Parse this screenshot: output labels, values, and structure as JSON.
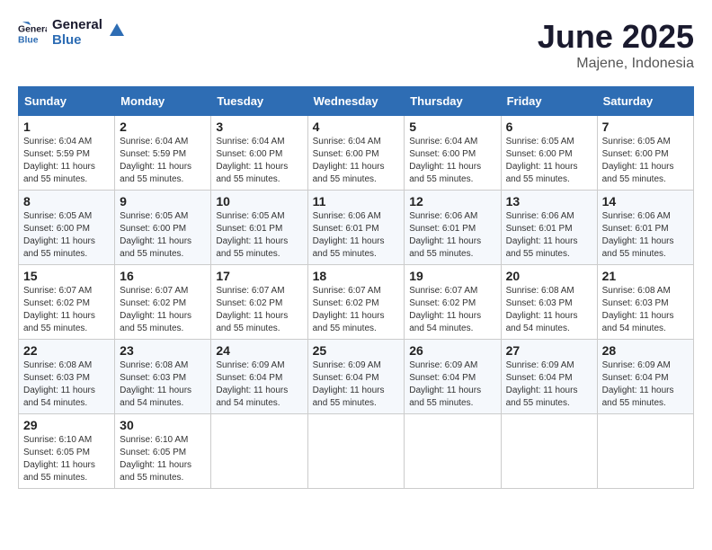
{
  "logo": {
    "line1": "General",
    "line2": "Blue"
  },
  "title": "June 2025",
  "location": "Majene, Indonesia",
  "days_header": [
    "Sunday",
    "Monday",
    "Tuesday",
    "Wednesday",
    "Thursday",
    "Friday",
    "Saturday"
  ],
  "weeks": [
    [
      {
        "day": "1",
        "sunrise": "6:04 AM",
        "sunset": "5:59 PM",
        "daylight": "11 hours and 55 minutes."
      },
      {
        "day": "2",
        "sunrise": "6:04 AM",
        "sunset": "5:59 PM",
        "daylight": "11 hours and 55 minutes."
      },
      {
        "day": "3",
        "sunrise": "6:04 AM",
        "sunset": "6:00 PM",
        "daylight": "11 hours and 55 minutes."
      },
      {
        "day": "4",
        "sunrise": "6:04 AM",
        "sunset": "6:00 PM",
        "daylight": "11 hours and 55 minutes."
      },
      {
        "day": "5",
        "sunrise": "6:04 AM",
        "sunset": "6:00 PM",
        "daylight": "11 hours and 55 minutes."
      },
      {
        "day": "6",
        "sunrise": "6:05 AM",
        "sunset": "6:00 PM",
        "daylight": "11 hours and 55 minutes."
      },
      {
        "day": "7",
        "sunrise": "6:05 AM",
        "sunset": "6:00 PM",
        "daylight": "11 hours and 55 minutes."
      }
    ],
    [
      {
        "day": "8",
        "sunrise": "6:05 AM",
        "sunset": "6:00 PM",
        "daylight": "11 hours and 55 minutes."
      },
      {
        "day": "9",
        "sunrise": "6:05 AM",
        "sunset": "6:00 PM",
        "daylight": "11 hours and 55 minutes."
      },
      {
        "day": "10",
        "sunrise": "6:05 AM",
        "sunset": "6:01 PM",
        "daylight": "11 hours and 55 minutes."
      },
      {
        "day": "11",
        "sunrise": "6:06 AM",
        "sunset": "6:01 PM",
        "daylight": "11 hours and 55 minutes."
      },
      {
        "day": "12",
        "sunrise": "6:06 AM",
        "sunset": "6:01 PM",
        "daylight": "11 hours and 55 minutes."
      },
      {
        "day": "13",
        "sunrise": "6:06 AM",
        "sunset": "6:01 PM",
        "daylight": "11 hours and 55 minutes."
      },
      {
        "day": "14",
        "sunrise": "6:06 AM",
        "sunset": "6:01 PM",
        "daylight": "11 hours and 55 minutes."
      }
    ],
    [
      {
        "day": "15",
        "sunrise": "6:07 AM",
        "sunset": "6:02 PM",
        "daylight": "11 hours and 55 minutes."
      },
      {
        "day": "16",
        "sunrise": "6:07 AM",
        "sunset": "6:02 PM",
        "daylight": "11 hours and 55 minutes."
      },
      {
        "day": "17",
        "sunrise": "6:07 AM",
        "sunset": "6:02 PM",
        "daylight": "11 hours and 55 minutes."
      },
      {
        "day": "18",
        "sunrise": "6:07 AM",
        "sunset": "6:02 PM",
        "daylight": "11 hours and 55 minutes."
      },
      {
        "day": "19",
        "sunrise": "6:07 AM",
        "sunset": "6:02 PM",
        "daylight": "11 hours and 54 minutes."
      },
      {
        "day": "20",
        "sunrise": "6:08 AM",
        "sunset": "6:03 PM",
        "daylight": "11 hours and 54 minutes."
      },
      {
        "day": "21",
        "sunrise": "6:08 AM",
        "sunset": "6:03 PM",
        "daylight": "11 hours and 54 minutes."
      }
    ],
    [
      {
        "day": "22",
        "sunrise": "6:08 AM",
        "sunset": "6:03 PM",
        "daylight": "11 hours and 54 minutes."
      },
      {
        "day": "23",
        "sunrise": "6:08 AM",
        "sunset": "6:03 PM",
        "daylight": "11 hours and 54 minutes."
      },
      {
        "day": "24",
        "sunrise": "6:09 AM",
        "sunset": "6:04 PM",
        "daylight": "11 hours and 54 minutes."
      },
      {
        "day": "25",
        "sunrise": "6:09 AM",
        "sunset": "6:04 PM",
        "daylight": "11 hours and 55 minutes."
      },
      {
        "day": "26",
        "sunrise": "6:09 AM",
        "sunset": "6:04 PM",
        "daylight": "11 hours and 55 minutes."
      },
      {
        "day": "27",
        "sunrise": "6:09 AM",
        "sunset": "6:04 PM",
        "daylight": "11 hours and 55 minutes."
      },
      {
        "day": "28",
        "sunrise": "6:09 AM",
        "sunset": "6:04 PM",
        "daylight": "11 hours and 55 minutes."
      }
    ],
    [
      {
        "day": "29",
        "sunrise": "6:10 AM",
        "sunset": "6:05 PM",
        "daylight": "11 hours and 55 minutes."
      },
      {
        "day": "30",
        "sunrise": "6:10 AM",
        "sunset": "6:05 PM",
        "daylight": "11 hours and 55 minutes."
      },
      null,
      null,
      null,
      null,
      null
    ]
  ]
}
